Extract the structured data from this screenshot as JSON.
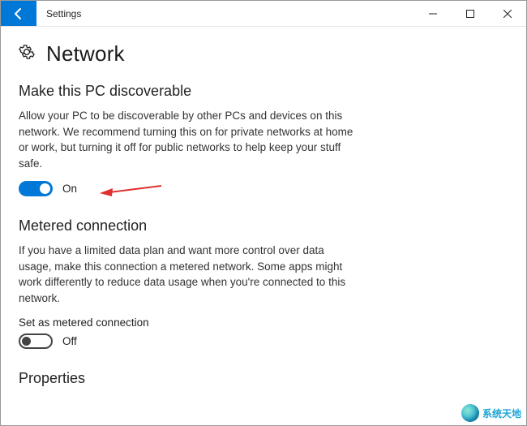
{
  "window": {
    "title": "Settings"
  },
  "page": {
    "title": "Network"
  },
  "sections": {
    "discoverable": {
      "title": "Make this PC discoverable",
      "desc": "Allow your PC to be discoverable by other PCs and devices on this network. We recommend turning this on for private networks at home or work, but turning it off for public networks to help keep your stuff safe.",
      "toggle_state": "On"
    },
    "metered": {
      "title": "Metered connection",
      "desc": "If you have a limited data plan and want more control over data usage, make this connection a metered network. Some apps might work differently to reduce data usage when you're connected to this network.",
      "sub_label": "Set as metered connection",
      "toggle_state": "Off"
    },
    "properties": {
      "title": "Properties"
    }
  },
  "watermark": {
    "text": "系统天地"
  }
}
